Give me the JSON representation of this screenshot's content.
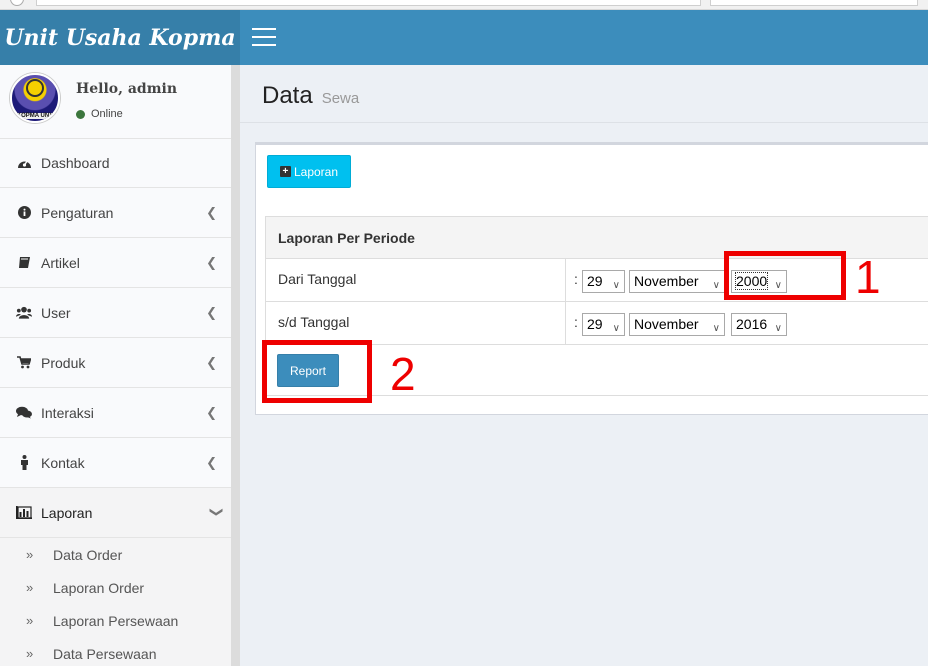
{
  "app": {
    "brand": "Unit Usaha Kopma"
  },
  "user": {
    "greeting": "Hello, admin",
    "status": "Online",
    "avatar_text": "KOPMA UNY"
  },
  "sidebar": {
    "items": [
      {
        "label": "Dashboard",
        "icon": "dashboard-icon",
        "has_chevron": false
      },
      {
        "label": "Pengaturan",
        "icon": "info-icon",
        "has_chevron": true
      },
      {
        "label": "Artikel",
        "icon": "book-icon",
        "has_chevron": true
      },
      {
        "label": "User",
        "icon": "users-icon",
        "has_chevron": true
      },
      {
        "label": "Produk",
        "icon": "cart-icon",
        "has_chevron": true
      },
      {
        "label": "Interaksi",
        "icon": "comments-icon",
        "has_chevron": true
      },
      {
        "label": "Kontak",
        "icon": "person-icon",
        "has_chevron": true
      },
      {
        "label": "Laporan",
        "icon": "bar-chart-icon",
        "has_chevron": true
      }
    ],
    "sub_items": [
      {
        "label": "Data Order"
      },
      {
        "label": "Laporan Order"
      },
      {
        "label": "Laporan Persewaan"
      },
      {
        "label": "Data Persewaan"
      }
    ]
  },
  "page": {
    "title": "Data",
    "subtitle": "Sewa"
  },
  "toolbar": {
    "laporan_label": "Laporan"
  },
  "report": {
    "header": "Laporan Per Periode",
    "from": {
      "label": "Dari Tanggal",
      "colon": ":",
      "day": "29",
      "month": "November",
      "year": "2000"
    },
    "to": {
      "label": "s/d Tanggal",
      "colon": ":",
      "day": "29",
      "month": "November",
      "year": "2016"
    },
    "report_button": "Report"
  },
  "annotations": {
    "one": "1",
    "two": "2"
  },
  "colors": {
    "header": "#3c8dbc",
    "logo_bg": "#367fa9",
    "info_button": "#00c0ef",
    "primary_button": "#3c8dbc",
    "annotation": "#ee0000"
  }
}
